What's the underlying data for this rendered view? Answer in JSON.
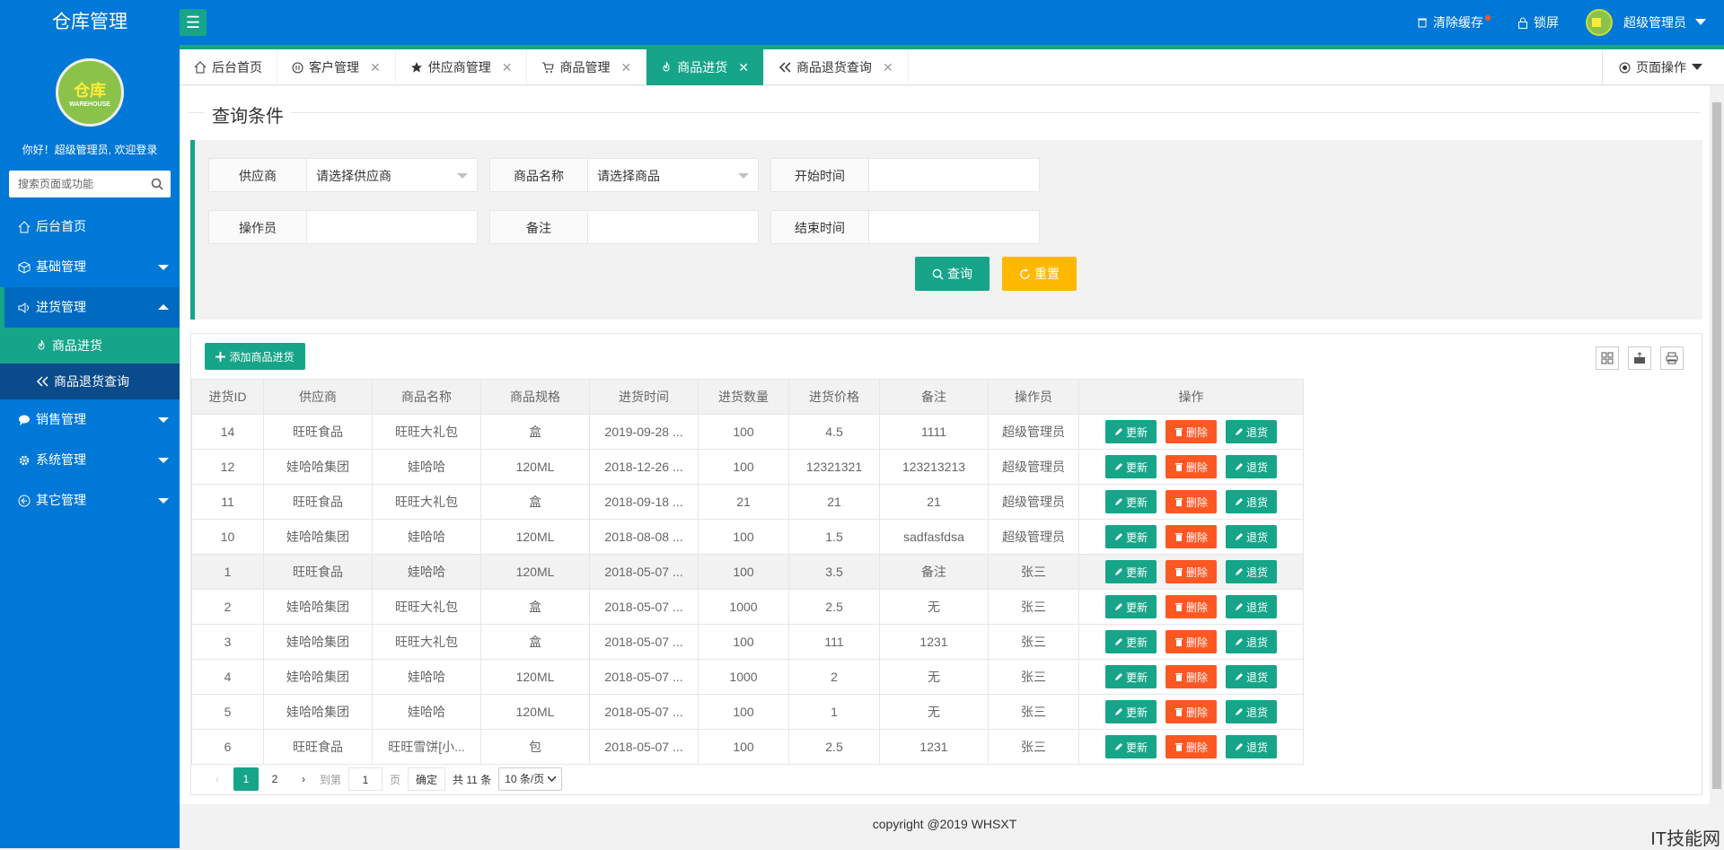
{
  "app": {
    "title": "仓库管理",
    "logo_text": "仓库",
    "logo_sub": "WAREHOUSE"
  },
  "top": {
    "clear_cache": "清除缓存",
    "lock": "锁屏",
    "user": "超级管理员"
  },
  "sidebar": {
    "welcome": "你好！超级管理员, 欢迎登录",
    "search_placeholder": "搜索页面或功能",
    "items": [
      {
        "label": "后台首页",
        "icon": "home-icon"
      },
      {
        "label": "基础管理",
        "icon": "cube-icon"
      },
      {
        "label": "进货管理",
        "icon": "speaker-icon"
      },
      {
        "label": "销售管理",
        "icon": "chat-icon"
      },
      {
        "label": "系统管理",
        "icon": "gear-icon"
      },
      {
        "label": "其它管理",
        "icon": "exit-icon"
      }
    ],
    "sub": [
      {
        "label": "商品进货"
      },
      {
        "label": "商品退货查询"
      }
    ]
  },
  "tabs": [
    {
      "label": "后台首页"
    },
    {
      "label": "客户管理"
    },
    {
      "label": "供应商管理"
    },
    {
      "label": "商品管理"
    },
    {
      "label": "商品进货"
    },
    {
      "label": "商品退货查询"
    }
  ],
  "page_op": "页面操作",
  "query": {
    "title": "查询条件",
    "supplier_label": "供应商",
    "supplier_value": "请选择供应商",
    "goods_label": "商品名称",
    "goods_value": "请选择商品",
    "start_label": "开始时间",
    "operator_label": "操作员",
    "remark_label": "备注",
    "end_label": "结束时间",
    "search_btn": "查询",
    "reset_btn": "重置"
  },
  "table": {
    "add_btn": "添加商品进货",
    "headers": [
      "进货ID",
      "供应商",
      "商品名称",
      "商品规格",
      "进货时间",
      "进货数量",
      "进货价格",
      "备注",
      "操作员",
      "操作"
    ],
    "rows": [
      [
        "14",
        "旺旺食品",
        "旺旺大礼包",
        "盒",
        "2019-09-28 ...",
        "100",
        "4.5",
        "1111",
        "超级管理员"
      ],
      [
        "12",
        "娃哈哈集团",
        "娃哈哈",
        "120ML",
        "2018-12-26 ...",
        "100",
        "12321321",
        "123213213",
        "超级管理员"
      ],
      [
        "11",
        "旺旺食品",
        "旺旺大礼包",
        "盒",
        "2018-09-18 ...",
        "21",
        "21",
        "21",
        "超级管理员"
      ],
      [
        "10",
        "娃哈哈集团",
        "娃哈哈",
        "120ML",
        "2018-08-08 ...",
        "100",
        "1.5",
        "sadfasfdsa",
        "超级管理员"
      ],
      [
        "1",
        "旺旺食品",
        "娃哈哈",
        "120ML",
        "2018-05-07 ...",
        "100",
        "3.5",
        "备注",
        "张三"
      ],
      [
        "2",
        "娃哈哈集团",
        "旺旺大礼包",
        "盒",
        "2018-05-07 ...",
        "1000",
        "2.5",
        "无",
        "张三"
      ],
      [
        "3",
        "娃哈哈集团",
        "旺旺大礼包",
        "盒",
        "2018-05-07 ...",
        "100",
        "111",
        "1231",
        "张三"
      ],
      [
        "4",
        "娃哈哈集团",
        "娃哈哈",
        "120ML",
        "2018-05-07 ...",
        "1000",
        "2",
        "无",
        "张三"
      ],
      [
        "5",
        "娃哈哈集团",
        "娃哈哈",
        "120ML",
        "2018-05-07 ...",
        "100",
        "1",
        "无",
        "张三"
      ],
      [
        "6",
        "旺旺食品",
        "旺旺雪饼[小...",
        "包",
        "2018-05-07 ...",
        "100",
        "2.5",
        "1231",
        "张三"
      ]
    ],
    "actions": {
      "update": "更新",
      "delete": "删除",
      "return": "退货"
    }
  },
  "pager": {
    "page1": "1",
    "page2": "2",
    "goto": "到第",
    "page_input": "1",
    "page_unit": "页",
    "ok": "确定",
    "total": "共 11 条",
    "size": "10 条/页"
  },
  "footer": "copyright @2019 WHSXT",
  "watermark": "IT技能网",
  "colors": {
    "primary": "#0078d7",
    "accent": "#16a589",
    "danger": "#ff5722",
    "warn": "#ffb800"
  }
}
